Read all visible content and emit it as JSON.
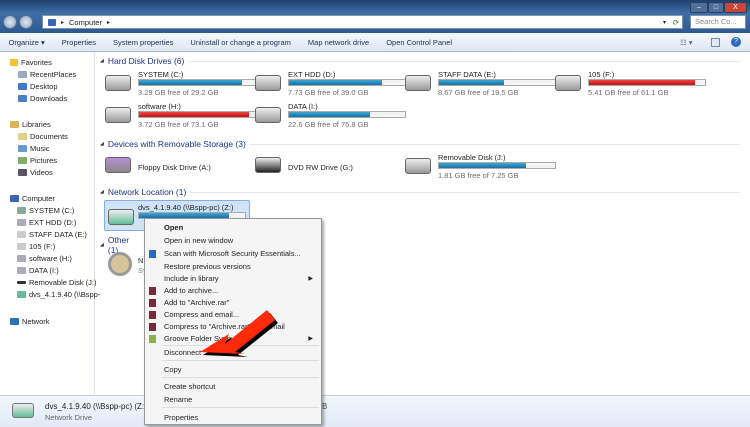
{
  "window": {
    "search_placeholder": "Search Co...",
    "breadcrumb": [
      "Computer"
    ],
    "controls": [
      "–",
      "□",
      "X"
    ]
  },
  "toolbar": {
    "organize": "Organize ▾",
    "items": [
      "Properties",
      "System properties",
      "Uninstall or change a program",
      "Map network drive",
      "Open Control Panel"
    ]
  },
  "sidebar": {
    "favorites": {
      "label": "Favorites",
      "items": [
        "RecentPlaces",
        "Desktop",
        "Downloads"
      ]
    },
    "libraries": {
      "label": "Libraries",
      "items": [
        "Documents",
        "Music",
        "Pictures",
        "Videos"
      ]
    },
    "computer": {
      "label": "Computer",
      "items": [
        "SYSTEM (C:)",
        "EXT HDD (D:)",
        "STAFF DATA (E:)",
        "105 (F:)",
        "software (H:)",
        "DATA (I:)",
        "Removable Disk (J:)",
        "dvs_4.1.9.40 (\\\\Bspp-"
      ]
    },
    "network": "Network"
  },
  "groups": {
    "hdd": "Hard Disk Drives (6)",
    "removable": "Devices with Removable Storage (3)",
    "network": "Network Location (1)",
    "other": "Other (1)"
  },
  "drives": [
    {
      "name": "SYSTEM (C:)",
      "free": "3.29 GB free of 29.2 GB",
      "used_pct": 89,
      "status": "blue"
    },
    {
      "name": "EXT HDD (D:)",
      "free": "7.73 GB free of 39.0 GB",
      "used_pct": 80,
      "status": "blue"
    },
    {
      "name": "STAFF DATA (E:)",
      "free": "8.67 GB free of 19.5 GB",
      "used_pct": 56,
      "status": "blue"
    },
    {
      "name": "105 (F:)",
      "free": "5.41 GB free of 61.1 GB",
      "used_pct": 91,
      "status": "red"
    },
    {
      "name": "software (H:)",
      "free": "3.72 GB free of 73.1 GB",
      "used_pct": 95,
      "status": "red"
    },
    {
      "name": "DATA (I:)",
      "free": "22.6 GB free of 75.8 GB",
      "used_pct": 70,
      "status": "blue"
    }
  ],
  "removable": [
    {
      "name": "Floppy Disk Drive (A:)"
    },
    {
      "name": "DVD RW Drive (G:)"
    },
    {
      "name": "Removable Disk (J:)",
      "free": "1.81 GB free of 7.25 GB",
      "used_pct": 75
    }
  ],
  "network_drive": {
    "name": "dvs_4.1.9.40 (\\\\Bspp-pc) (Z:)",
    "used_pct": 85
  },
  "other_item": {
    "name": "N",
    "sub": "Sy"
  },
  "context_menu": [
    "Open",
    "Open in new window",
    "Scan with Microsoft Security Essentials...",
    "Restore previous versions",
    "Include in library",
    "Add to archive...",
    "Add to \"Archive.rar\"",
    "Compress and email...",
    "Compress to \"Archive.rar\" and email",
    "Groove Folder Sync",
    "Disconnect",
    "Copy",
    "Create shortcut",
    "Rename",
    "Properties"
  ],
  "details": {
    "name": "dvs_4.1.9.40 (\\\\Bspp-pc) (Z:)",
    "type": "Network Drive",
    "extra": "B"
  },
  "colors": {
    "bar_blue": "#1a6fa2",
    "bar_red": "#d01a1a",
    "arrow": "#ff2a0a"
  }
}
